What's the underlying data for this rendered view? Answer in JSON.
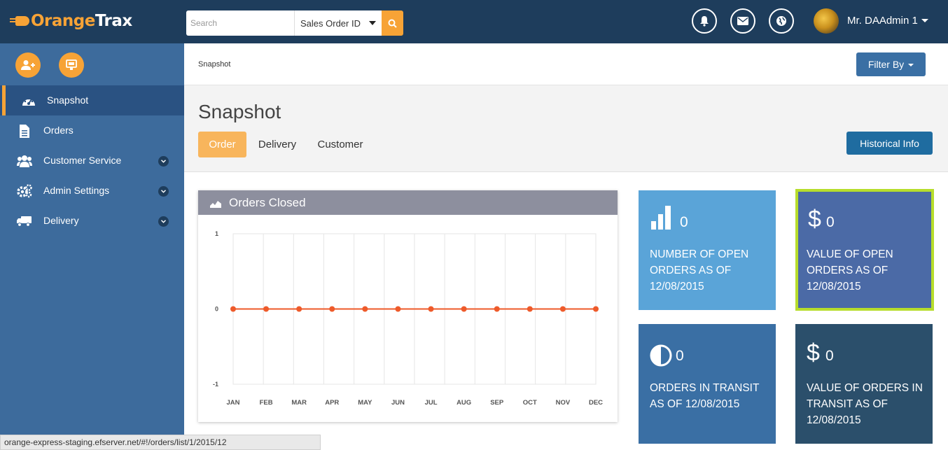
{
  "app": {
    "logo_orange": "Orange",
    "logo_white": "Trax"
  },
  "search": {
    "placeholder": "Search",
    "value": "",
    "type_selected": "Sales Order ID"
  },
  "header": {
    "user_name": "Mr. DAAdmin 1",
    "icons": [
      "bell-icon",
      "envelope-icon",
      "globe-icon"
    ]
  },
  "sidebar": {
    "quick_actions": [
      "add-user-icon",
      "delivery-board-icon"
    ],
    "items": [
      {
        "label": "Snapshot",
        "icon": "dashboard-icon",
        "active": true,
        "expandable": false
      },
      {
        "label": "Orders",
        "icon": "document-icon",
        "active": false,
        "expandable": false
      },
      {
        "label": "Customer Service",
        "icon": "users-icon",
        "active": false,
        "expandable": true
      },
      {
        "label": "Admin Settings",
        "icon": "gears-icon",
        "active": false,
        "expandable": true
      },
      {
        "label": "Delivery",
        "icon": "truck-icon",
        "active": false,
        "expandable": true
      }
    ]
  },
  "breadcrumb": "Snapshot",
  "filter_label": "Filter By",
  "page": {
    "title": "Snapshot",
    "tabs": [
      {
        "label": "Order",
        "active": true
      },
      {
        "label": "Delivery",
        "active": false
      },
      {
        "label": "Customer",
        "active": false
      }
    ],
    "historical_label": "Historical Info"
  },
  "chart_panel": {
    "title": "Orders Closed"
  },
  "chart_data": {
    "type": "line",
    "title": "Orders Closed",
    "categories": [
      "JAN",
      "FEB",
      "MAR",
      "APR",
      "MAY",
      "JUN",
      "JUL",
      "AUG",
      "SEP",
      "OCT",
      "NOV",
      "DEC"
    ],
    "series": [
      {
        "values": [
          0,
          0,
          0,
          0,
          0,
          0,
          0,
          0,
          0,
          0,
          0,
          0
        ],
        "color": "#ee5a2a"
      }
    ],
    "yticks": [
      "1",
      "0",
      "-1"
    ],
    "ylim": [
      -1,
      1
    ],
    "grid": true
  },
  "tiles": [
    {
      "value": "0",
      "label": "NUMBER OF OPEN ORDERS AS OF 12/08/2015",
      "icon": "bar-chart-icon",
      "bg": "#5aa4d8"
    },
    {
      "value": "0",
      "label": "VALUE OF OPEN ORDERS AS OF 12/08/2015",
      "icon": "dollar-icon",
      "bg": "#4b6aa6",
      "highlight": "#b7dd2c"
    },
    {
      "value": "0",
      "label": "ORDERS IN TRANSIT AS OF 12/08/2015",
      "icon": "half-circle-icon",
      "bg": "#3a6fa4"
    },
    {
      "value": "0",
      "label": "VALUE OF ORDERS IN TRANSIT AS OF 12/08/2015",
      "icon": "dollar-icon",
      "bg": "#2b4f6b"
    }
  ],
  "status_url": "orange-express-staging.efserver.net/#!/orders/list/1/2015/12"
}
